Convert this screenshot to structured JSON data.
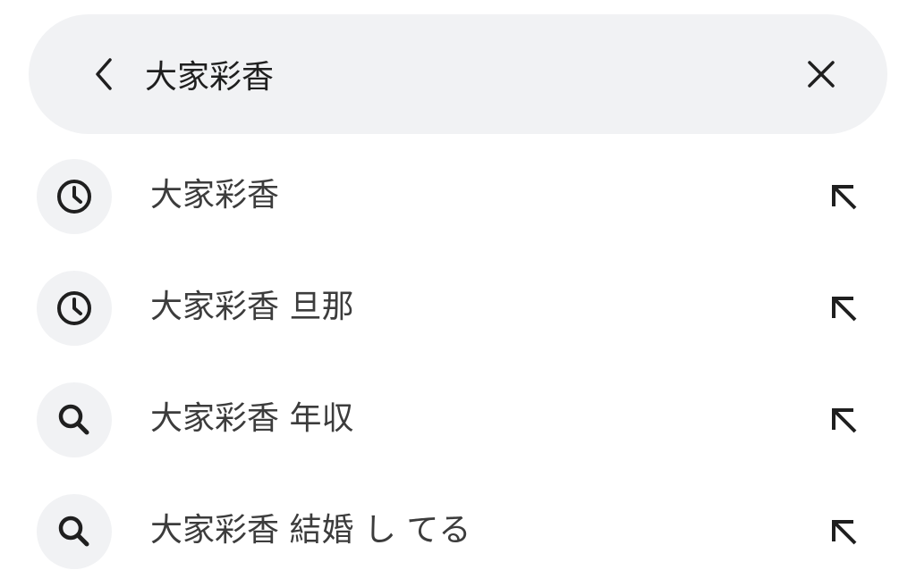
{
  "search": {
    "query": "大家彩香",
    "back_icon": "chevron-left-icon",
    "clear_icon": "close-icon"
  },
  "suggestions": [
    {
      "icon": "history-icon",
      "text": "大家彩香",
      "action_icon": "arrow-up-left-icon"
    },
    {
      "icon": "history-icon",
      "text": "大家彩香 旦那",
      "action_icon": "arrow-up-left-icon"
    },
    {
      "icon": "search-icon",
      "text": "大家彩香 年収",
      "action_icon": "arrow-up-left-icon"
    },
    {
      "icon": "search-icon",
      "text": "大家彩香 結婚 し てる",
      "action_icon": "arrow-up-left-icon"
    }
  ],
  "colors": {
    "bar_background": "#f1f2f4",
    "icon": "#1f1f1f",
    "suggestion_text": "#3c3c3c"
  }
}
